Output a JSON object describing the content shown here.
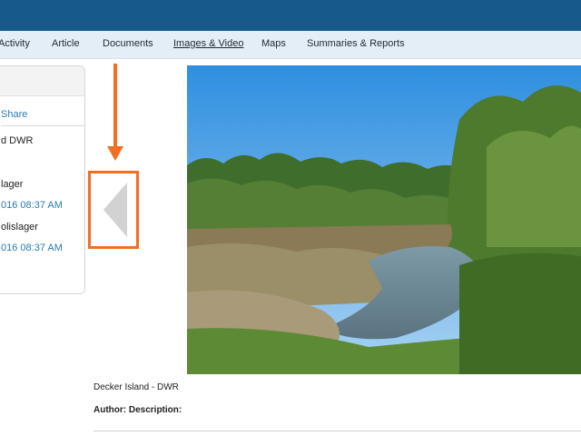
{
  "nav": {
    "items": [
      {
        "label": "Activity"
      },
      {
        "label": "Article"
      },
      {
        "label": "Documents"
      },
      {
        "label": "Images & Video"
      },
      {
        "label": "Maps"
      },
      {
        "label": "Summaries & Reports"
      }
    ],
    "active": "Images & Video"
  },
  "sidebar": {
    "share_label": "Share",
    "owner": "d DWR",
    "creator": "lager",
    "created": "016 08:37 AM",
    "modifier": "olislager",
    "modified": "016 08:37 AM"
  },
  "viewer": {
    "caption": "Decker Island - DWR",
    "author_label": "Author: Description:",
    "prev_icon": "chevron-left-icon",
    "annotation_color": "#f26f22"
  },
  "colors": {
    "topbar": "#17598a",
    "navbar": "#e4eef6",
    "link": "#2a7ab4"
  }
}
